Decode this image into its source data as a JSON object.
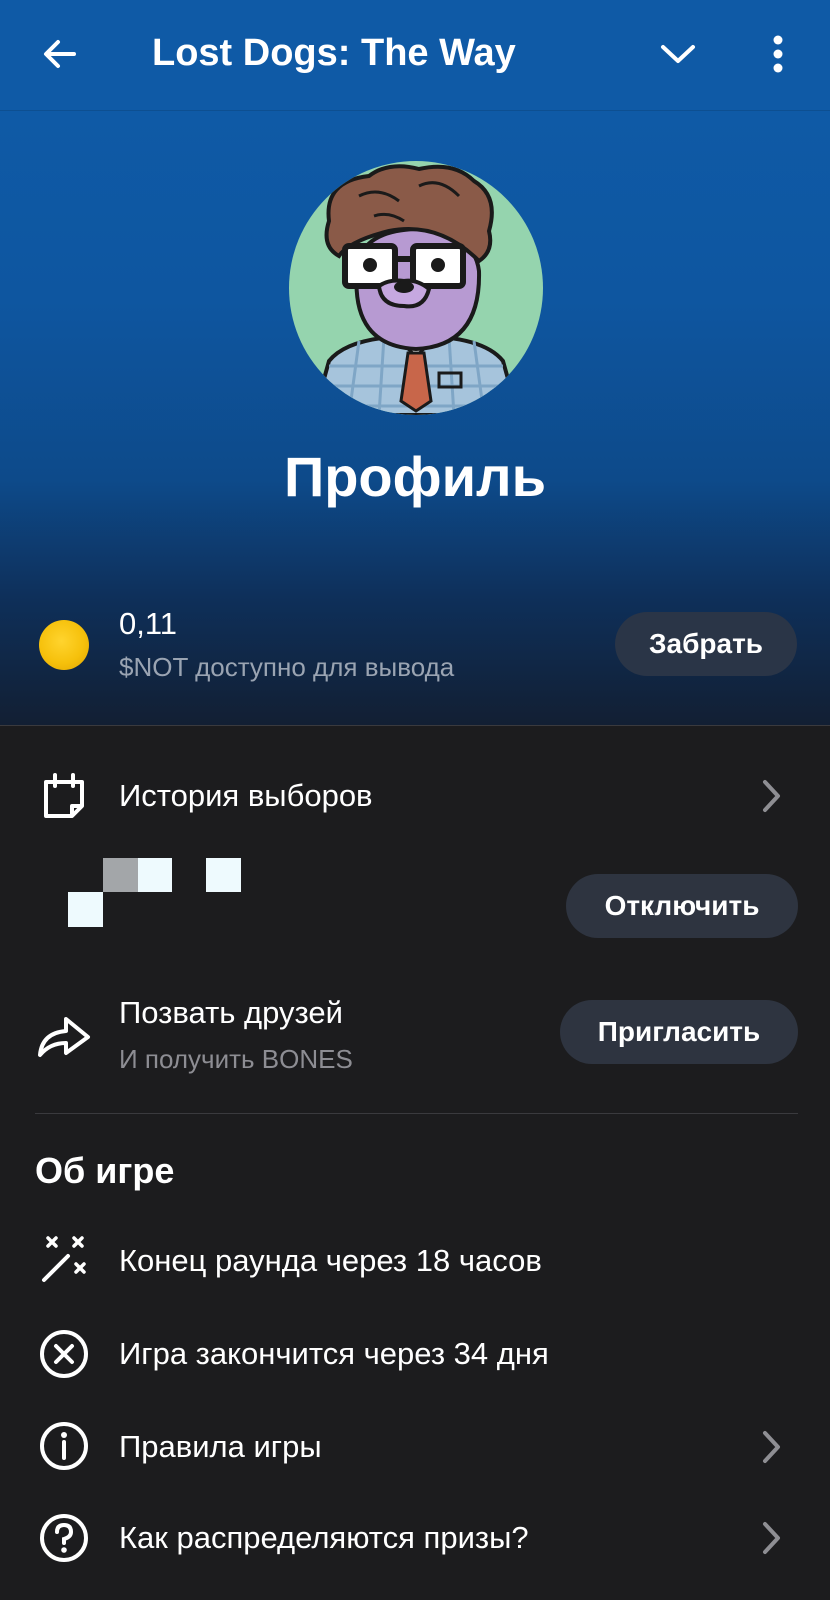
{
  "header": {
    "title": "Lost Dogs: The Way",
    "icons": {
      "back": "arrow-left-icon",
      "collapse": "chevron-down-icon",
      "menu": "more-vertical-icon"
    }
  },
  "profile": {
    "title": "Профиль"
  },
  "balance": {
    "amount": "0,11",
    "caption": "$NOT доступно для вывода",
    "claim_label": "Забрать",
    "coin_color": "#f6c10c"
  },
  "history": {
    "label": "История выборов",
    "icon": "calendar-icon"
  },
  "connected": {
    "disconnect_label": "Отключить"
  },
  "invite": {
    "label": "Позвать друзей",
    "caption": "И получить BONES",
    "button_label": "Пригласить",
    "icon": "share-arrow-icon"
  },
  "about": {
    "title": "Об игре",
    "items": [
      {
        "label": "Конец раунда через 18 часов",
        "icon": "magic-wand-icon"
      },
      {
        "label": "Игра закончится через 34 дня",
        "icon": "close-circle-icon"
      },
      {
        "label": "Правила игры",
        "icon": "info-icon"
      },
      {
        "label": "Как распределяются призы?",
        "icon": "question-icon"
      }
    ]
  },
  "colors": {
    "header_blue": "#0f5aa6",
    "background": "#1c1c1e",
    "pill": "#2e3440",
    "muted_text": "#8d8d93"
  }
}
